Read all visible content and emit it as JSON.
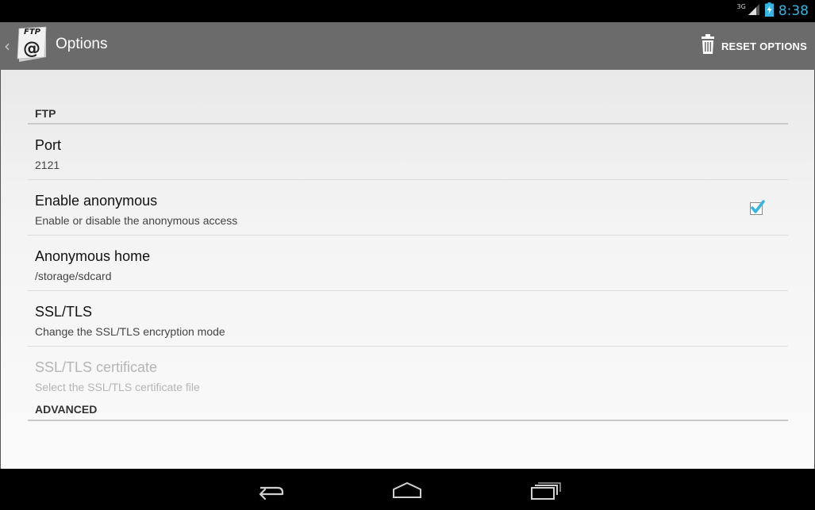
{
  "status_bar": {
    "network": "3G",
    "time": "8:38"
  },
  "action_bar": {
    "app_icon_text": "FTP",
    "title": "Options",
    "reset_label": "RESET OPTIONS"
  },
  "preferences": {
    "ftp_category": "FTP",
    "port": {
      "title": "Port",
      "summary": "2121"
    },
    "enable_anonymous": {
      "title": "Enable anonymous",
      "summary": "Enable or disable the anonymous access",
      "checked": true
    },
    "anonymous_home": {
      "title": "Anonymous home",
      "summary": "/storage/sdcard"
    },
    "ssl_tls": {
      "title": "SSL/TLS",
      "summary": "Change the SSL/TLS encryption mode"
    },
    "ssl_certificate": {
      "title": "SSL/TLS certificate",
      "summary": "Select the SSL/TLS certificate file",
      "enabled": false
    },
    "advanced_category": "ADVANCED"
  },
  "nav_bar": {
    "back_icon": "back-icon",
    "home_icon": "home-icon",
    "recents_icon": "recent-apps-icon"
  },
  "colors": {
    "accent": "#33b5e5",
    "action_bar": "#6b6b6b"
  }
}
